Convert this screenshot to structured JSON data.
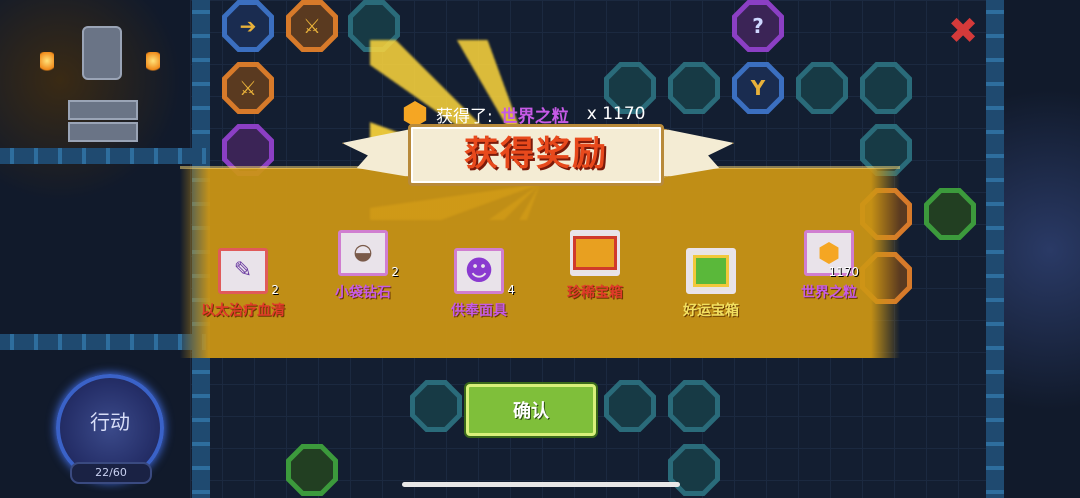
{
  "header": {
    "got_label": "获得了:",
    "got_item": "世界之粒",
    "got_qty": "x 1170"
  },
  "banner": {
    "title": "获得奖励"
  },
  "rewards": [
    {
      "name": "以太治疗血清",
      "qty": "2",
      "icon": "serum-syringe-icon",
      "name_color": "#e03a2a"
    },
    {
      "name": "小袋钻石",
      "qty": "2",
      "icon": "diamond-pouch-icon",
      "name_color": "#c65ae6"
    },
    {
      "name": "供奉面具",
      "qty": "4",
      "icon": "purple-mask-icon",
      "name_color": "#c65ae6"
    },
    {
      "name": "珍稀宝箱",
      "qty": "",
      "icon": "rare-chest-icon",
      "name_color": "#e03a2a"
    },
    {
      "name": "好运宝箱",
      "qty": "",
      "icon": "lucky-chest-icon",
      "name_color": "#f2e060"
    },
    {
      "name": "世界之粒",
      "qty": "1170",
      "icon": "world-grain-cube-icon",
      "name_color": "#c65ae6"
    }
  ],
  "confirm_label": "确认",
  "action": {
    "label": "行动",
    "points": "22/60"
  },
  "colors": {
    "band": "#cd9614",
    "confirm": "#7fbf3a",
    "title": "#e8491c"
  }
}
